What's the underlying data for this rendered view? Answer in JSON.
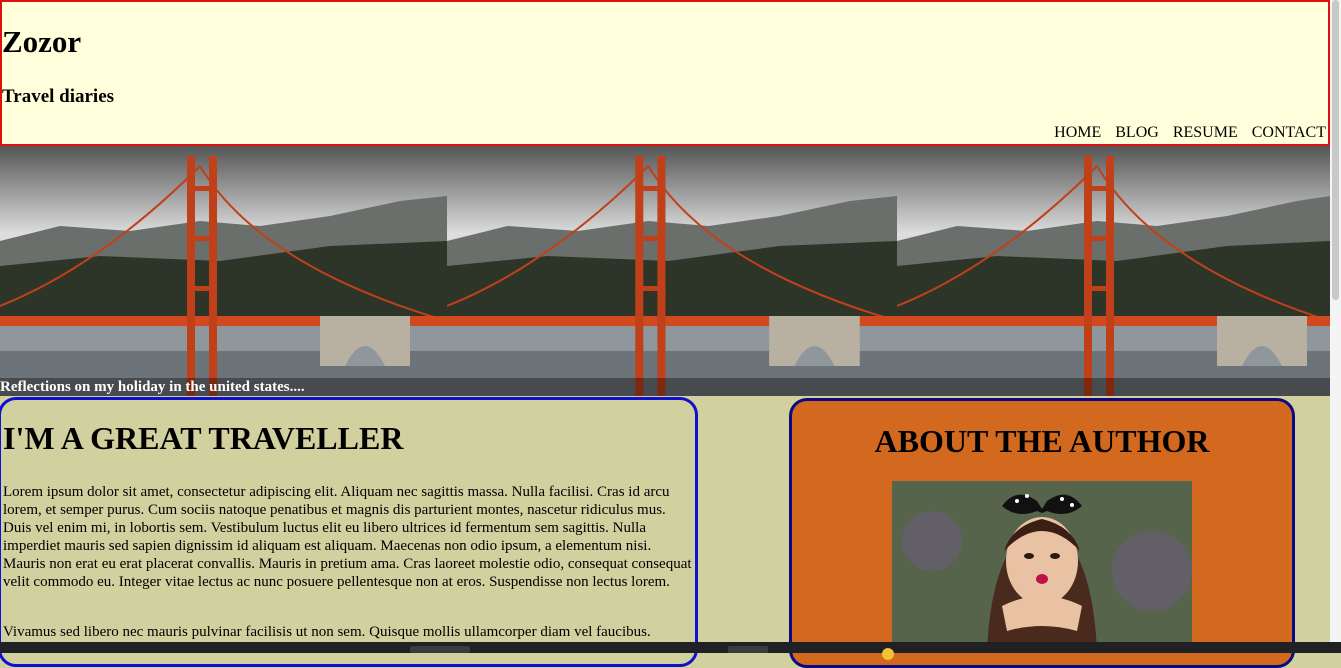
{
  "header": {
    "title": "Zozor",
    "subtitle": "Travel diaries"
  },
  "nav": {
    "items": [
      {
        "label": "HOME"
      },
      {
        "label": "BLOG"
      },
      {
        "label": "RESUME"
      },
      {
        "label": "CONTACT"
      }
    ]
  },
  "banner": {
    "caption": "Reflections on my holiday in the united states....",
    "image": "golden-gate-bridge-photo"
  },
  "article": {
    "heading": "I'M A GREAT TRAVELLER",
    "paragraphs": [
      "Lorem ipsum dolor sit amet, consectetur adipiscing elit. Aliquam nec sagittis massa. Nulla facilisi. Cras id arcu lorem, et semper purus. Cum sociis natoque penatibus et magnis dis parturient montes, nascetur ridiculus mus. Duis vel enim mi, in lobortis sem. Vestibulum luctus elit eu libero ultrices id fermentum sem sagittis. Nulla imperdiet mauris sed sapien dignissim id aliquam est aliquam. Maecenas non odio ipsum, a elementum nisi. Mauris non erat eu erat placerat convallis. Mauris in pretium ama. Cras laoreet molestie odio, consequat consequat velit commodo eu. Integer vitae lectus ac nunc posuere pellentesque non at eros. Suspendisse non lectus lorem.",
      "Vivamus sed libero nec mauris pulvinar facilisis ut non sem. Quisque mollis ullamcorper diam vel faucibus."
    ]
  },
  "about": {
    "heading": "ABOUT THE AUTHOR",
    "photo": "author-photo"
  },
  "colors": {
    "page_bg": "#d1d09f",
    "header_bg": "#ffffdc",
    "header_border": "#e01010",
    "article_border": "#1010d0",
    "about_bg": "#d2691e",
    "about_border": "#0a0a80"
  }
}
